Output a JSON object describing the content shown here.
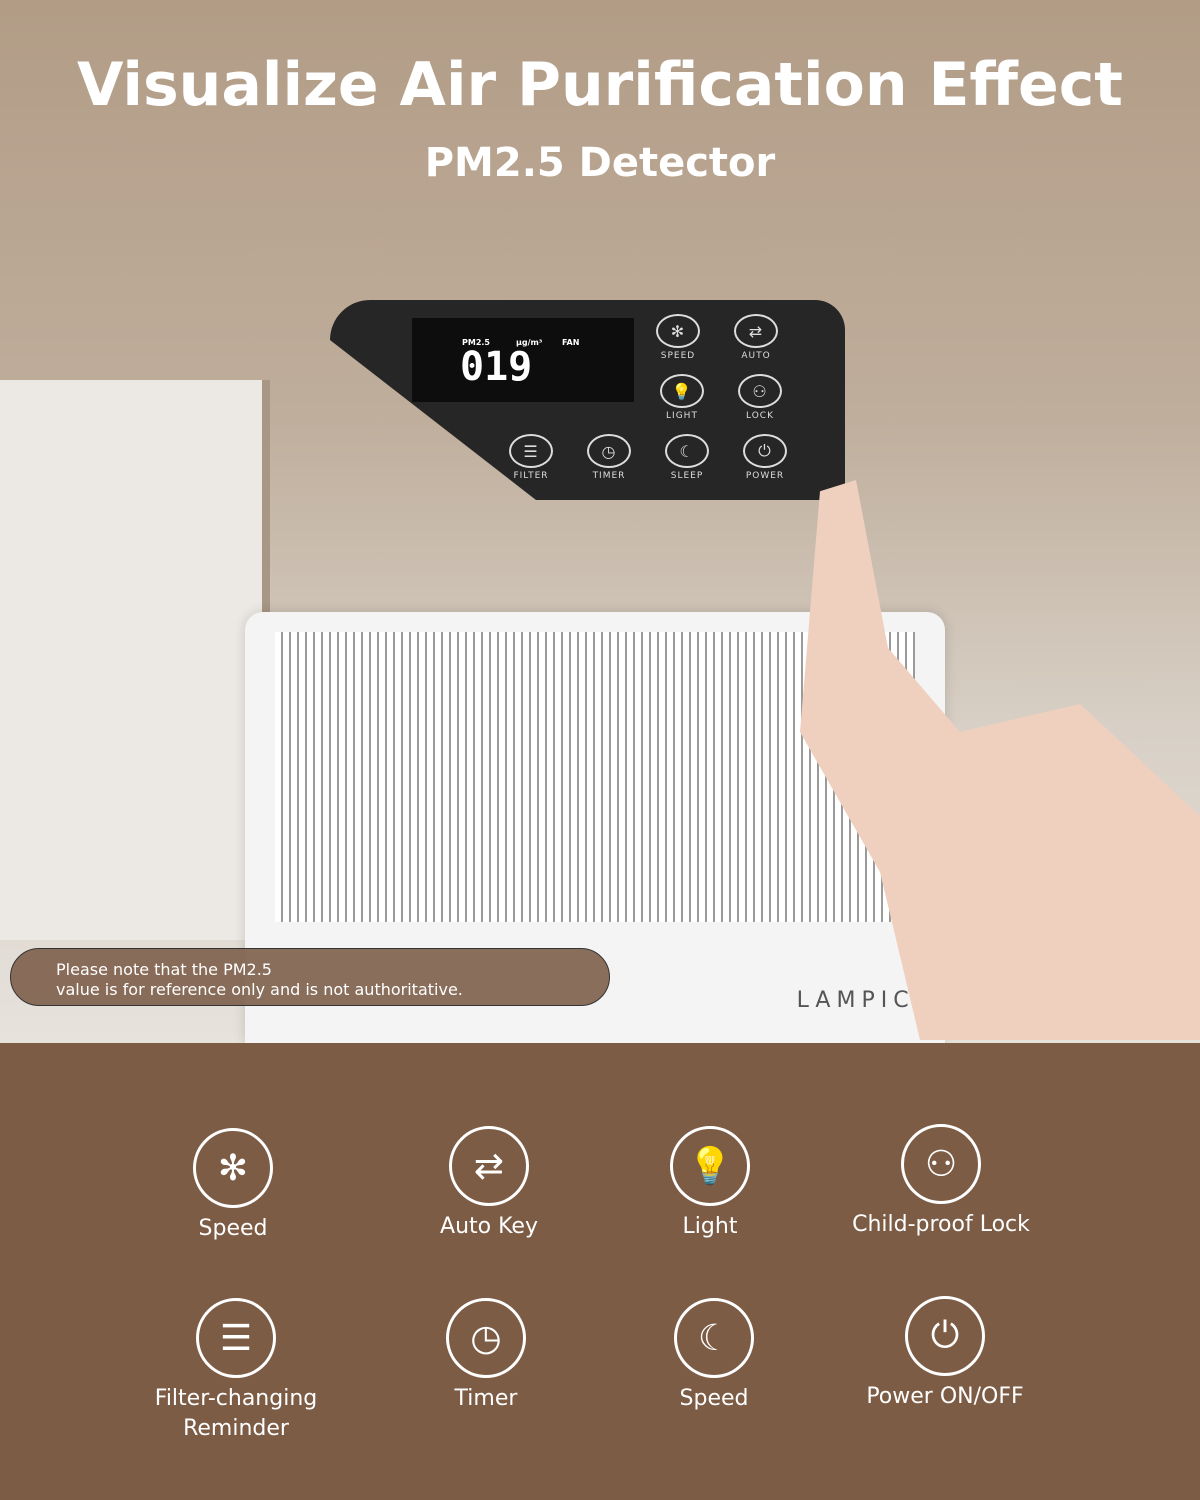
{
  "title": "Visualize Air Purification Effect",
  "subtitle": "PM2.5 Detector",
  "panel": {
    "pm_label": "PM2.5",
    "unit": "μg/m³",
    "fan_label": "FAN",
    "reading": "019",
    "buttons": [
      "SPEED",
      "AUTO",
      "LIGHT",
      "LOCK",
      "FILTER",
      "TIMER",
      "SLEEP",
      "POWER"
    ]
  },
  "brand": "LAMPICK",
  "note": {
    "line1": "Please note that the PM2.5",
    "line2": "value is for reference only and is not authoritative."
  },
  "features": [
    {
      "label": "Speed",
      "icon": "fan-icon"
    },
    {
      "label": "Auto Key",
      "icon": "auto-cycle-icon"
    },
    {
      "label": "Light",
      "icon": "light-bulb-icon"
    },
    {
      "label": "Child-proof Lock",
      "icon": "user-lock-icon"
    },
    {
      "label": "Filter-changing Reminder",
      "icon": "filter-icon"
    },
    {
      "label": "Timer",
      "icon": "clock-icon"
    },
    {
      "label": "Speed",
      "icon": "sleep-moon-icon"
    },
    {
      "label": "Power ON/OFF",
      "icon": "power-icon"
    }
  ],
  "colors": {
    "bottom_bg": "#7d5c46",
    "hero_bg": "#b29c86"
  }
}
